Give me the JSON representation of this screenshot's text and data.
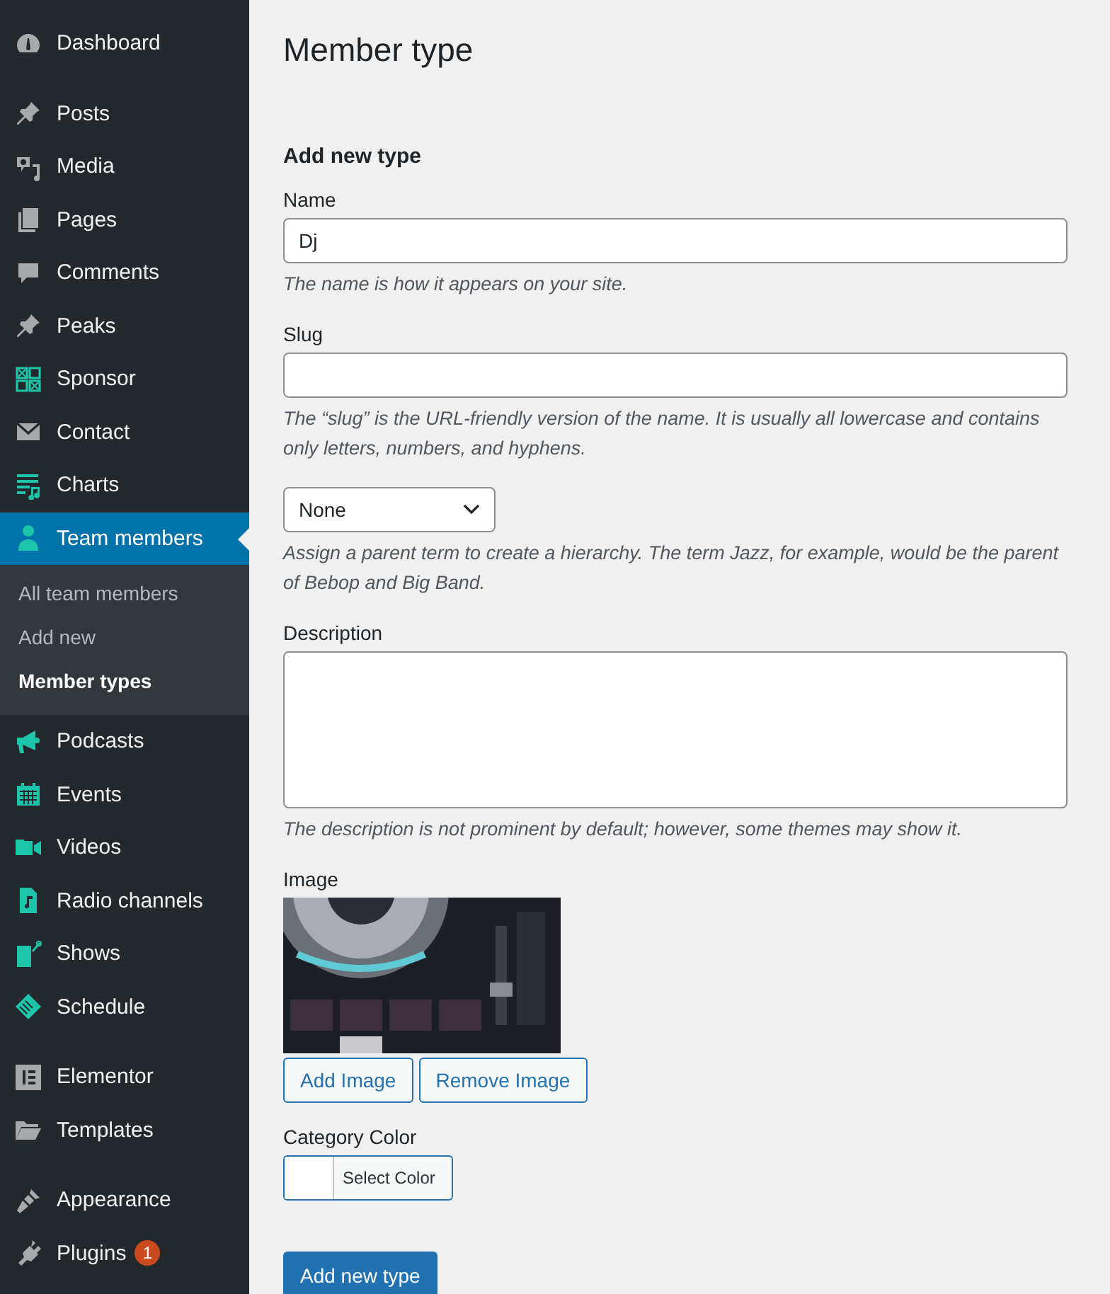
{
  "sidebar": {
    "groups": [
      [
        {
          "label": "Dashboard",
          "selected": false,
          "color": "#a7aaad"
        }
      ],
      [
        {
          "label": "Posts",
          "selected": false,
          "color": "#a7aaad"
        },
        {
          "label": "Media",
          "selected": false,
          "color": "#a7aaad"
        },
        {
          "label": "Pages",
          "selected": false,
          "color": "#a7aaad"
        },
        {
          "label": "Comments",
          "selected": false,
          "color": "#a7aaad"
        },
        {
          "label": "Peaks",
          "selected": false,
          "color": "#a7aaad"
        },
        {
          "label": "Sponsor",
          "selected": false,
          "color": "#1cc4a9"
        },
        {
          "label": "Contact",
          "selected": false,
          "color": "#a7aaad"
        },
        {
          "label": "Charts",
          "selected": false,
          "color": "#1cc4a9"
        },
        {
          "label": "Team members",
          "selected": true,
          "color": "#1cc4a9",
          "submenu": [
            {
              "label": "All team members",
              "selected": false
            },
            {
              "label": "Add new",
              "selected": false
            },
            {
              "label": "Member types",
              "selected": true
            }
          ]
        },
        {
          "label": "Podcasts",
          "selected": false,
          "color": "#1cc4a9"
        },
        {
          "label": "Events",
          "selected": false,
          "color": "#1cc4a9"
        },
        {
          "label": "Videos",
          "selected": false,
          "color": "#1cc4a9"
        },
        {
          "label": "Radio channels",
          "selected": false,
          "color": "#1cc4a9"
        },
        {
          "label": "Shows",
          "selected": false,
          "color": "#1cc4a9"
        },
        {
          "label": "Schedule",
          "selected": false,
          "color": "#1cc4a9"
        }
      ],
      [
        {
          "label": "Elementor",
          "selected": false,
          "color": "#a7aaad"
        },
        {
          "label": "Templates",
          "selected": false,
          "color": "#a7aaad"
        }
      ],
      [
        {
          "label": "Appearance",
          "selected": false,
          "color": "#a7aaad"
        },
        {
          "label": "Plugins",
          "selected": false,
          "color": "#a7aaad",
          "badge": "1"
        }
      ]
    ]
  },
  "page": {
    "title": "Member type",
    "section_title": "Add new type",
    "name": {
      "label": "Name",
      "value": "Dj",
      "help": "The name is how it appears on your site."
    },
    "slug": {
      "label": "Slug",
      "help": "The “slug” is the URL-friendly version of the name. It is usually all lowercase and contains only letters, numbers, and hyphens."
    },
    "parent": {
      "value": "None",
      "help": "Assign a parent term to create a hierarchy. The term Jazz, for example, would be the parent of Bebop and Big Band."
    },
    "description": {
      "label": "Description",
      "help": "The description is not prominent by default; however, some themes may show it."
    },
    "image": {
      "label": "Image",
      "buttons": [
        "Add Image",
        "Remove Image"
      ]
    },
    "category_color": {
      "label": "Category Color",
      "color": "#ffffff",
      "button": "Select Color"
    },
    "submit": "Add new type"
  }
}
